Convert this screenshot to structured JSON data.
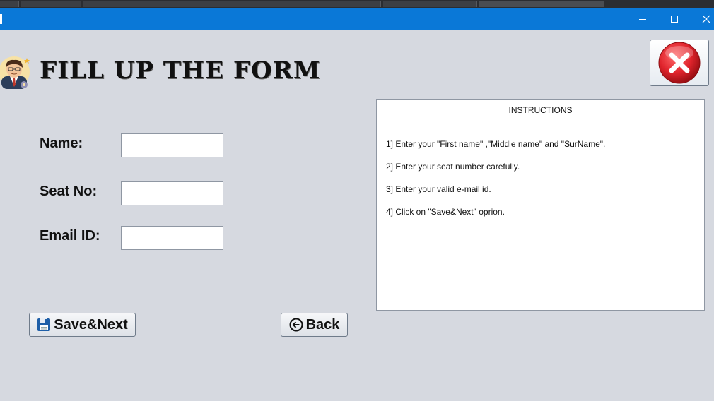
{
  "window": {
    "minimize_icon": "minimize-icon",
    "maximize_icon": "maximize-icon",
    "close_icon": "close-icon"
  },
  "header": {
    "title": "FILL UP THE FORM",
    "avatar_icon": "user-avatar-icon"
  },
  "form": {
    "name_label": "Name:",
    "seat_label": "Seat No:",
    "email_label": "Email ID:",
    "name_value": "",
    "seat_value": "",
    "email_value": ""
  },
  "instructions": {
    "title": "INSTRUCTIONS",
    "lines": [
      "1] Enter your \"First name\" ,\"Middle name\" and \"SurName\".",
      "2] Enter your seat number carefully.",
      "3] Enter your valid e-mail id.",
      "4] Click on \"Save&Next\" oprion."
    ]
  },
  "buttons": {
    "save_label": "Save&Next",
    "save_icon": "floppy-disk-icon",
    "back_label": "Back",
    "back_icon": "back-arrow-icon",
    "exit_icon": "red-x-icon"
  },
  "colors": {
    "titlebar": "#0a78d7",
    "background": "#d6d9e0",
    "exit_red": "#e0242c"
  }
}
